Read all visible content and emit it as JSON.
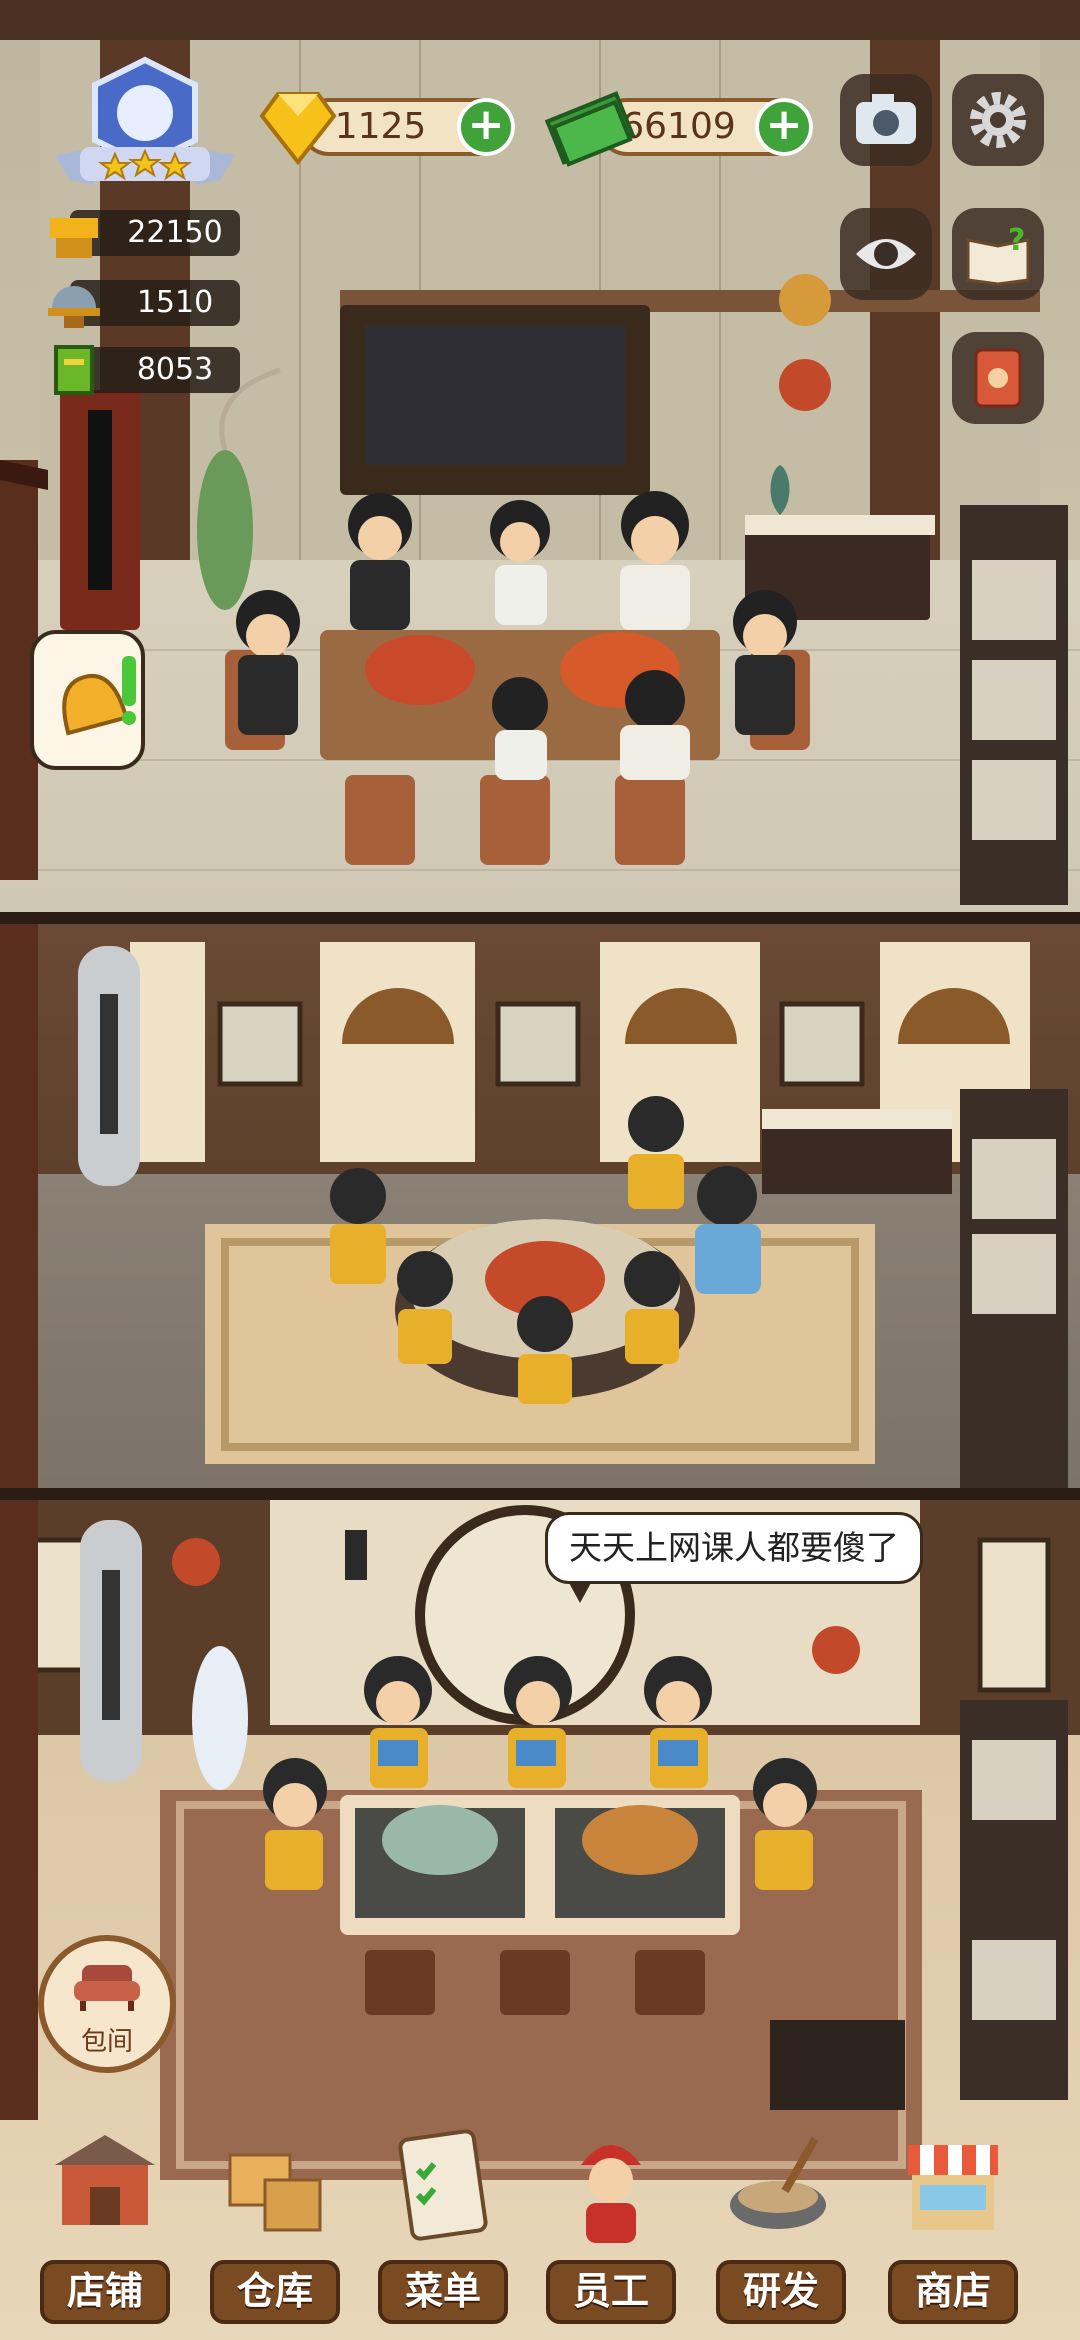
{
  "hud": {
    "gems": "1125",
    "cash": "66109",
    "stats": [
      {
        "name": "counter",
        "value": "22150"
      },
      {
        "name": "dish-cover",
        "value": "1510"
      },
      {
        "name": "menu-book",
        "value": "8053"
      }
    ],
    "level_stars": 3
  },
  "room3": {
    "speech": "天天上网课人都要傻了",
    "private_room_label": "包间"
  },
  "nav": [
    {
      "id": "store",
      "label": "店铺",
      "icon": "shop-house-icon"
    },
    {
      "id": "warehouse",
      "label": "仓库",
      "icon": "boxes-icon"
    },
    {
      "id": "menu",
      "label": "菜单",
      "icon": "clipboard-icon"
    },
    {
      "id": "staff",
      "label": "员工",
      "icon": "chef-icon"
    },
    {
      "id": "research",
      "label": "研发",
      "icon": "wok-icon"
    },
    {
      "id": "shop",
      "label": "商店",
      "icon": "market-stall-icon"
    }
  ],
  "colors": {
    "plus": "#3fa33a",
    "nav": "#7a4a22",
    "pill": "#f1e3c4"
  }
}
